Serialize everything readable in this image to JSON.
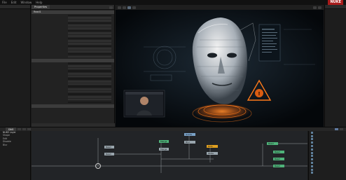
{
  "app": {
    "brand": "NUKE"
  },
  "menu": [
    "File",
    "Edit",
    "Window",
    "Help"
  ],
  "left_tree": {
    "title": "",
    "items": [
      "",
      "",
      "",
      "",
      ""
    ]
  },
  "properties": {
    "tab": "Properties",
    "sections": [
      "Read1",
      "",
      ""
    ],
    "rows_a": [
      "",
      "",
      "",
      "",
      "",
      "",
      "",
      "",
      "",
      "",
      "",
      "",
      "",
      "",
      "",
      "",
      ""
    ],
    "rows_b": [
      "",
      "",
      "",
      "",
      "",
      "",
      "",
      "",
      "",
      "",
      "",
      "",
      "",
      "",
      "",
      ""
    ]
  },
  "viewer": {
    "face_glyph": "◆",
    "warning_glyph": "!"
  },
  "timeline": {
    "tabs": [
      "",
      "DAG"
    ]
  },
  "node_info": {
    "lines": [
      "NUKE Layer",
      "Shape",
      "Edit",
      "Disable",
      "Blur"
    ]
  },
  "node_graph": {
    "nodes": [
      {
        "label": "Read"
      },
      {
        "label": "Read"
      },
      {
        "label": "Merge"
      },
      {
        "label": "Merge"
      },
      {
        "label": "Grade"
      },
      {
        "label": "Blur"
      },
      {
        "label": "Roto"
      },
      {
        "label": "Write"
      },
      {
        "label": "Read"
      },
      {
        "label": "Read"
      },
      {
        "label": "Read"
      },
      {
        "label": "Read"
      }
    ]
  },
  "toolbox": {
    "items": [
      "",
      "",
      "",
      "",
      "",
      "",
      "",
      "",
      "",
      "",
      "",
      "",
      ""
    ]
  },
  "colors": {
    "accent": "#e05a1a",
    "node_green": "#4fb37a",
    "node_blue": "#7aa2c8"
  }
}
